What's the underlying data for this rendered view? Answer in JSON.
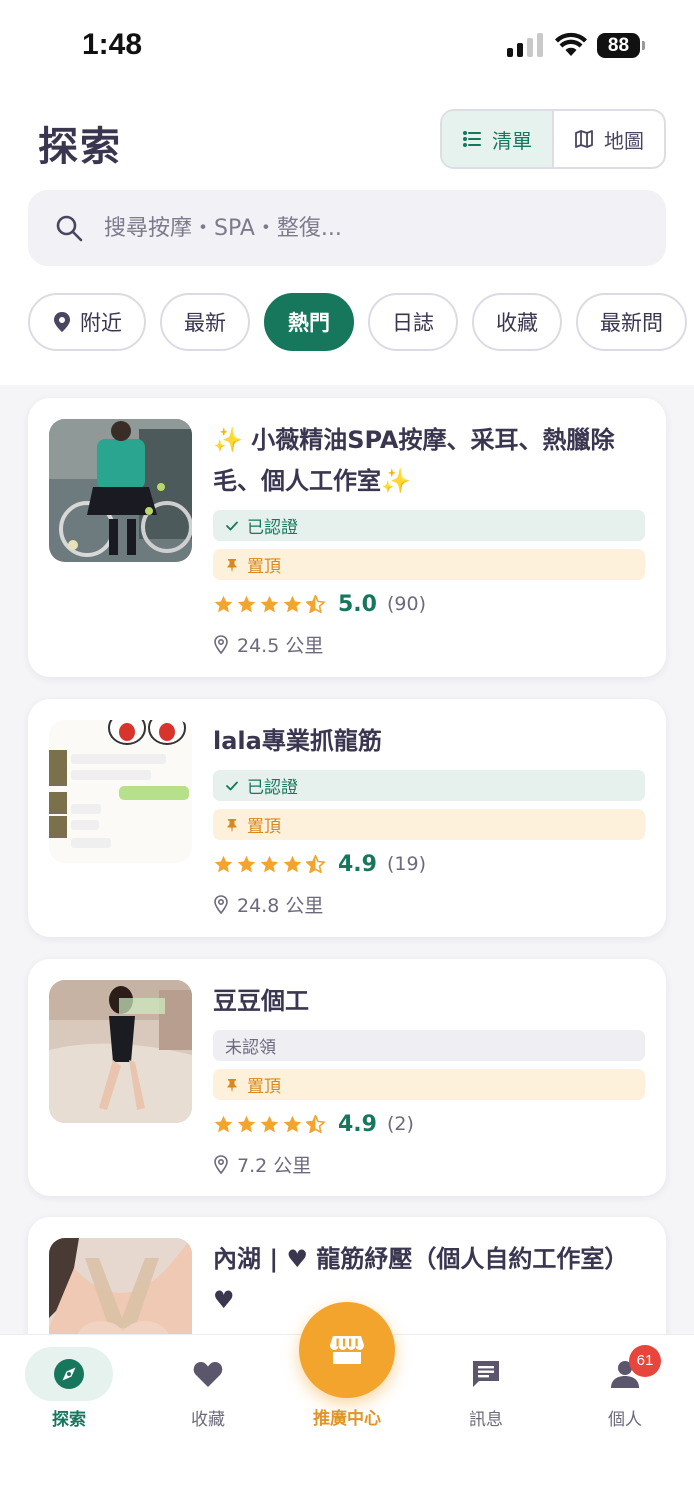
{
  "status_bar": {
    "time": "1:48",
    "battery": "88"
  },
  "header": {
    "title": "探索"
  },
  "view_toggle": {
    "list_label": "清單",
    "map_label": "地圖",
    "selected": "list"
  },
  "search": {
    "placeholder": "搜尋按摩・SPA・整復..."
  },
  "filters": [
    {
      "label": "附近",
      "icon": "location-pin-icon",
      "active": false
    },
    {
      "label": "最新",
      "active": false
    },
    {
      "label": "熱門",
      "active": true
    },
    {
      "label": "日誌",
      "active": false
    },
    {
      "label": "收藏",
      "active": false
    },
    {
      "label": "最新問",
      "active": false
    }
  ],
  "listings": [
    {
      "title": "✨ 小薇精油SPA按摩、采耳、熱臘除毛、個人工作室✨",
      "status": "已認證",
      "pinned": "置頂",
      "rating": "5.0",
      "stars": 4.5,
      "reviews": "(90)",
      "distance": "24.5 公里"
    },
    {
      "title": "lala專業抓龍筋",
      "status": "已認證",
      "pinned": "置頂",
      "rating": "4.9",
      "stars": 4.5,
      "reviews": "(19)",
      "distance": "24.8 公里"
    },
    {
      "title": "豆豆個工",
      "status": "未認領",
      "pinned": "置頂",
      "rating": "4.9",
      "stars": 4.5,
      "reviews": "(2)",
      "distance": "7.2 公里"
    },
    {
      "title": "內湖 | ♥ 龍筋紓壓（個人自約工作室）♥"
    }
  ],
  "tabbar": {
    "explore": "探索",
    "favorites": "收藏",
    "promo": "推廣中心",
    "messages": "訊息",
    "profile": "個人",
    "profile_badge": "61"
  },
  "colors": {
    "accent": "#17775d",
    "star": "#f3a42c",
    "promo": "#f3a42c",
    "badge": "#e8453c"
  }
}
